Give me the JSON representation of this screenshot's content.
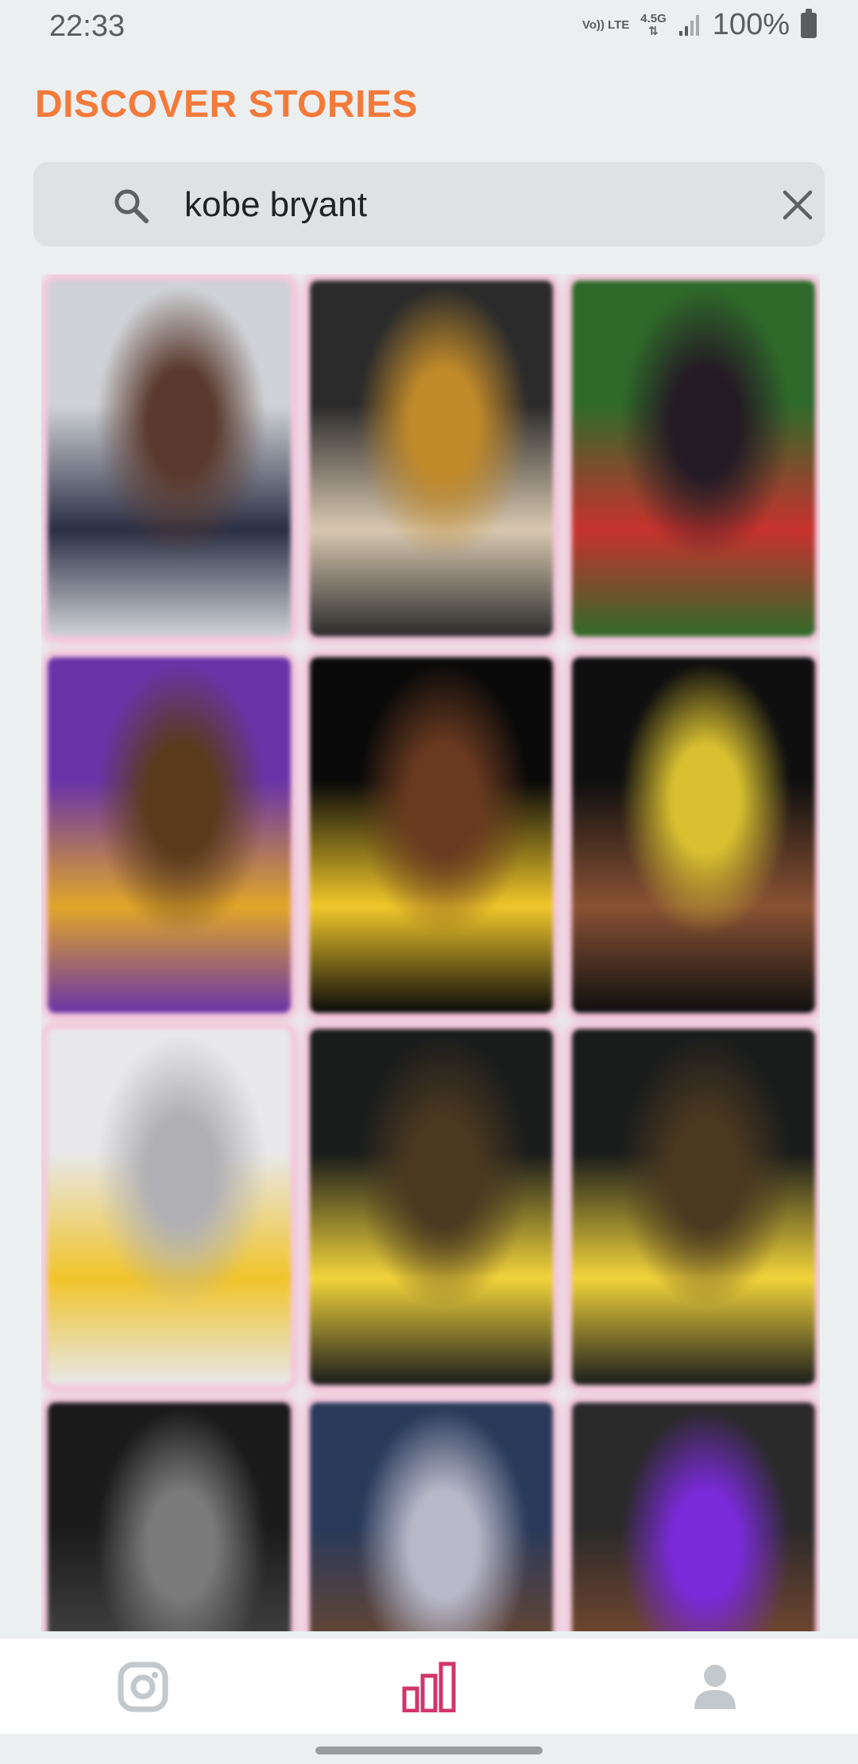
{
  "status_bar": {
    "time": "22:33",
    "volte_label": "Vo)) LTE",
    "network_label": "4.5G",
    "battery_text": "100%",
    "icons": [
      "volte-icon",
      "network-arrows-icon",
      "signal-icon",
      "battery-icon"
    ]
  },
  "header": {
    "title": "DISCOVER STORIES",
    "title_color": "#f47a3a"
  },
  "search": {
    "query": "kobe bryant",
    "placeholder": "",
    "icon": "search-icon",
    "clear_icon": "close-icon"
  },
  "stories": [
    {
      "name": "story-card-1",
      "palette": [
        "#cfd2d6",
        "#2a2e44",
        "#5a3a2e"
      ]
    },
    {
      "name": "story-card-2",
      "palette": [
        "#2b2b2b",
        "#d8c8b0",
        "#c08a2a"
      ]
    },
    {
      "name": "story-card-3",
      "palette": [
        "#2f6a2a",
        "#c8322e",
        "#241a24"
      ]
    },
    {
      "name": "story-card-4",
      "palette": [
        "#6a34a8",
        "#e0a628",
        "#5a3a1a"
      ]
    },
    {
      "name": "story-card-5",
      "palette": [
        "#0a0a0a",
        "#f0c82a",
        "#6a3a20"
      ]
    },
    {
      "name": "story-card-6",
      "palette": [
        "#0f0f0f",
        "#8a5234",
        "#d8c030"
      ]
    },
    {
      "name": "story-card-7",
      "palette": [
        "#e8e8ea",
        "#f0c42a",
        "#b0b0b4"
      ]
    },
    {
      "name": "story-card-8",
      "palette": [
        "#1a1c1c",
        "#f2d43a",
        "#4a3820"
      ]
    },
    {
      "name": "story-card-9",
      "palette": [
        "#1a1c1c",
        "#f2d43a",
        "#4a3820"
      ]
    },
    {
      "name": "story-card-10",
      "palette": [
        "#1a1a1a",
        "#444444",
        "#7a7a7a"
      ]
    },
    {
      "name": "story-card-11",
      "palette": [
        "#2a3a5a",
        "#6a4630",
        "#b8b8c8"
      ]
    },
    {
      "name": "story-card-12",
      "palette": [
        "#2a2a2a",
        "#7a4a30",
        "#7a2ad8"
      ]
    }
  ],
  "bottom_nav": {
    "items": [
      {
        "icon": "instagram-icon",
        "active": false
      },
      {
        "icon": "bar-chart-icon",
        "active": true
      },
      {
        "icon": "profile-icon",
        "active": false
      }
    ],
    "active_color": "#d1356a",
    "inactive_color": "#c2c8cc"
  }
}
